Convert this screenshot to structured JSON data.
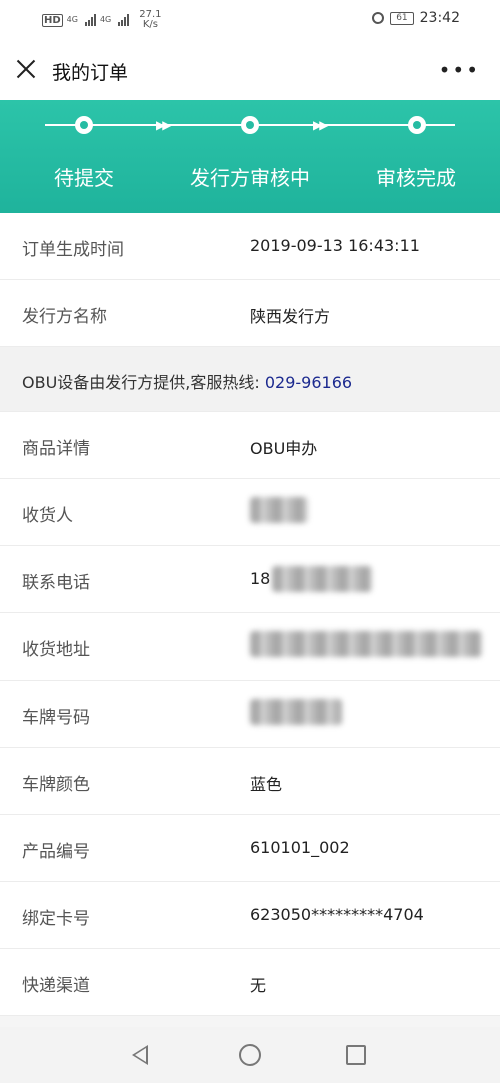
{
  "status_bar": {
    "hd": "HD",
    "net1": "4G",
    "net2": "4G",
    "speed_value": "27.1",
    "speed_unit": "K/s",
    "battery": "61",
    "time": "23:42"
  },
  "header": {
    "title": "我的订单",
    "close_icon": "close-icon",
    "more_icon": "more-icon",
    "more_label": "•••"
  },
  "progress": {
    "steps": [
      {
        "label": "待提交"
      },
      {
        "label": "发行方审核中"
      },
      {
        "label": "审核完成"
      }
    ],
    "arrow": "▶▶"
  },
  "details": {
    "order_time": {
      "label": "订单生成时间",
      "value": "2019-09-13 16:43:11"
    },
    "issuer": {
      "label": "发行方名称",
      "value": "陕西发行方"
    },
    "notice": {
      "text": "OBU设备由发行方提供,客服热线: ",
      "phone": "029-96166"
    },
    "product": {
      "label": "商品详情",
      "value": "OBU申办"
    },
    "receiver": {
      "label": "收货人"
    },
    "contact": {
      "label": "联系电话",
      "value_prefix": "18"
    },
    "address": {
      "label": "收货地址"
    },
    "plate": {
      "label": "车牌号码"
    },
    "plate_color": {
      "label": "车牌颜色",
      "value": "蓝色"
    },
    "product_no": {
      "label": "产品编号",
      "value": "610101_002"
    },
    "card_no": {
      "label": "绑定卡号",
      "value": "623050*********4704"
    },
    "delivery": {
      "label": "快递渠道",
      "value": "无"
    }
  },
  "nav": {
    "back_icon": "back-triangle-icon",
    "home_icon": "home-circle-icon",
    "recent_icon": "recent-square-icon"
  }
}
